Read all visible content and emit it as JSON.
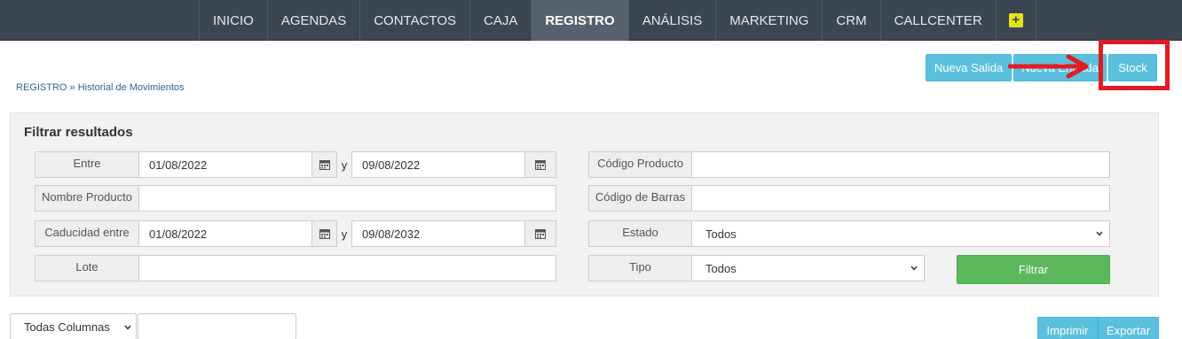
{
  "nav": {
    "items": [
      {
        "label": "INICIO",
        "active": false
      },
      {
        "label": "AGENDAS",
        "active": false
      },
      {
        "label": "CONTACTOS",
        "active": false
      },
      {
        "label": "CAJA",
        "active": false
      },
      {
        "label": "REGISTRO",
        "active": true
      },
      {
        "label": "ANÁLISIS",
        "active": false
      },
      {
        "label": "MARKETING",
        "active": false
      },
      {
        "label": "CRM",
        "active": false
      },
      {
        "label": "CALLCENTER",
        "active": false
      }
    ],
    "plus_icon": "plus-icon",
    "colors": {
      "bar": "#3c4652",
      "active": "#56616d",
      "plus": "#e6e21a"
    }
  },
  "actions": {
    "nueva_salida": "Nueva Salida",
    "nueva_entrada": "Nueva Entrada",
    "stock": "Stock"
  },
  "annotation": {
    "color": "#e11b22"
  },
  "breadcrumb": {
    "root": "REGISTRO",
    "separator": " » ",
    "current": "Historial de Movimientos"
  },
  "filter": {
    "title": "Filtrar resultados",
    "entre_label": "Entre",
    "entre_from": "01/08/2022",
    "entre_to": "09/08/2022",
    "and_label": "y",
    "nombre_label": "Nombre Producto",
    "nombre_value": "",
    "caducidad_label": "Caducidad entre",
    "caducidad_from": "01/08/2022",
    "caducidad_to": "09/08/2032",
    "lote_label": "Lote",
    "lote_value": "",
    "codigo_label": "Código Producto",
    "codigo_value": "",
    "barras_label": "Código de Barras",
    "barras_value": "",
    "estado_label": "Estado",
    "estado_value": "Todos",
    "tipo_label": "Tipo",
    "tipo_value": "Todos",
    "filtrar_button": "Filtrar"
  },
  "table_controls": {
    "columns_select": "Todas Columnas",
    "search_value": "",
    "print_button": "Imprimir",
    "export_button": "Exportar"
  },
  "colors": {
    "info": "#5bc0de",
    "success": "#5cb85c",
    "link": "#2a6496"
  }
}
